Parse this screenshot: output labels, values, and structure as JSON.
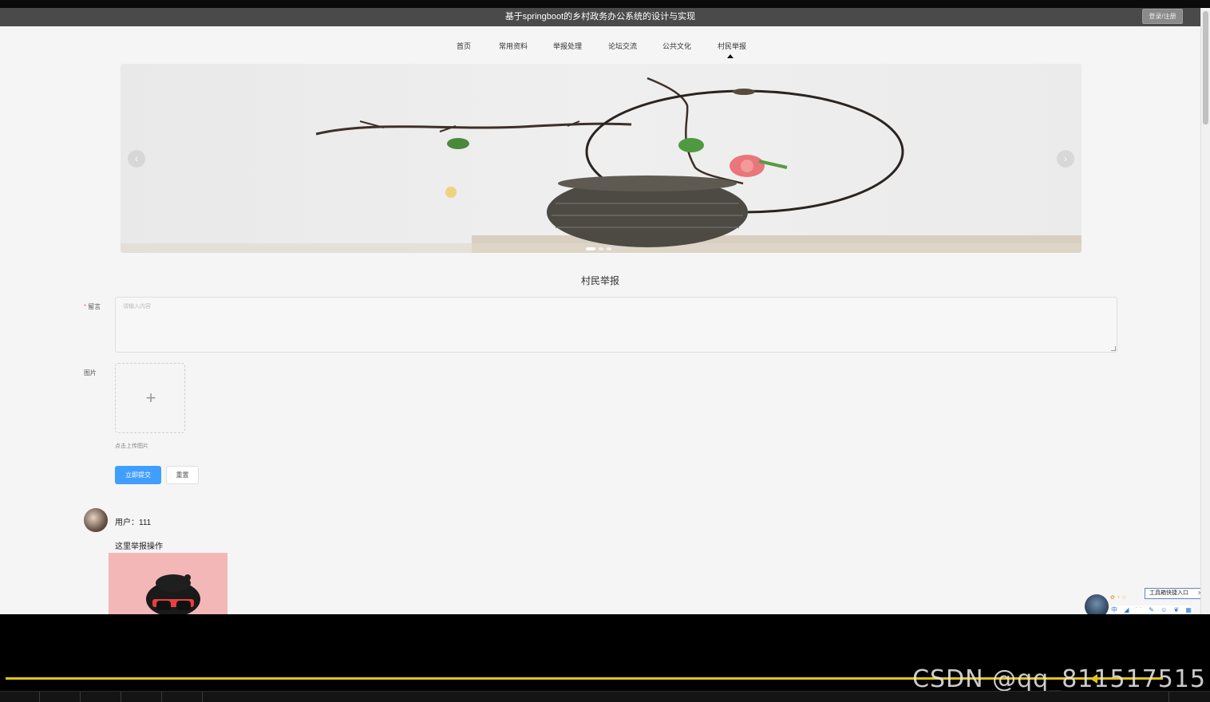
{
  "header": {
    "title": "基于springboot的乡村政务办公系统的设计与实现",
    "login_label": "登录/注册"
  },
  "nav": {
    "items": [
      "首页",
      "常用资料",
      "举报处理",
      "论坛交流",
      "公共文化",
      "村民举报"
    ],
    "active_index": 5
  },
  "banner": {
    "prev_icon": "chevron-left-icon",
    "next_icon": "chevron-right-icon",
    "slide_count": 3,
    "active_slide": 0
  },
  "form": {
    "section_title": "村民举报",
    "message_label": "留言",
    "message_required_mark": "*",
    "message_placeholder": "请输入内容",
    "image_label": "图片",
    "upload_tip": "点击上传图片",
    "submit_label": "立即提交",
    "reset_label": "重置"
  },
  "comments": [
    {
      "user": "用户：111",
      "content": "这里举报操作"
    }
  ],
  "toolbox": {
    "label": "工具箱快捷入口",
    "close": "✕",
    "icons_text": "中 ◢ ˙˙ ✎ ☺ ❦ ▦ ⚲",
    "stars": "✿ ◔ ☆"
  },
  "player": {
    "watermark": "CSDN @qq_811517515",
    "progress": 0.952
  },
  "colors": {
    "primary": "#409eff",
    "titlebar": "#4a4a4a",
    "progress": "#e2c21a"
  }
}
